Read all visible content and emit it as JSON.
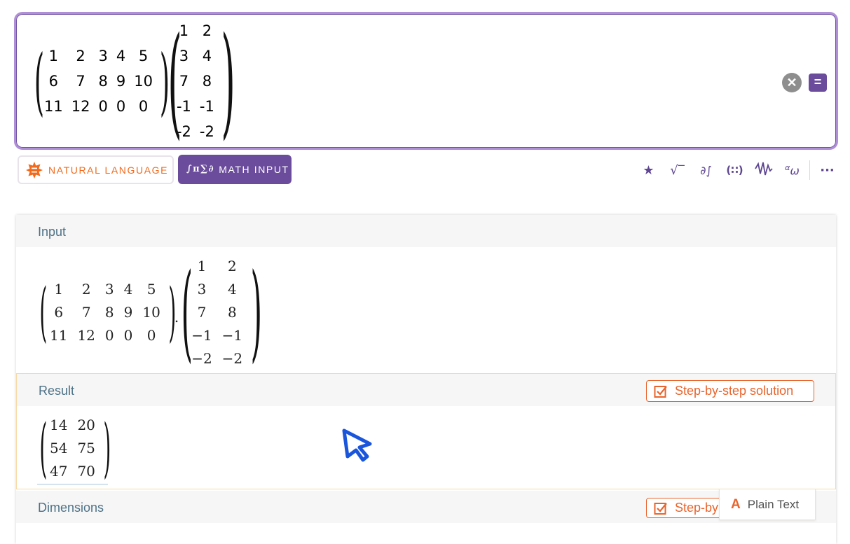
{
  "input": {
    "matrix_a": [
      [
        "1",
        "2",
        "3",
        "4",
        "5"
      ],
      [
        "6",
        "7",
        "8",
        "9",
        "10"
      ],
      [
        "11",
        "12",
        "0",
        "0",
        "0"
      ]
    ],
    "matrix_b": [
      [
        "1",
        "2"
      ],
      [
        "3",
        "4"
      ],
      [
        "7",
        "8"
      ],
      [
        "-1",
        "-1"
      ],
      [
        "-2",
        "-2"
      ]
    ],
    "clear_symbol": "✕",
    "compute_symbol": "="
  },
  "toolbar": {
    "natural_language_label": "NATURAL LANGUAGE",
    "math_input_label": "MATH INPUT",
    "math_input_icon_text": "∫π∑∂",
    "icons": [
      "star-icon",
      "sqrt-icon",
      "calculus-icon",
      "matrix-icon",
      "function-icon",
      "greek-icon",
      "more-icon"
    ]
  },
  "pods": {
    "input": {
      "title": "Input",
      "matrix_a": [
        [
          "1",
          "2",
          "3",
          "4",
          "5"
        ],
        [
          "6",
          "7",
          "8",
          "9",
          "10"
        ],
        [
          "11",
          "12",
          "0",
          "0",
          "0"
        ]
      ],
      "dot": ".",
      "matrix_b": [
        [
          "1",
          "2"
        ],
        [
          "3",
          "4"
        ],
        [
          "7",
          "8"
        ],
        [
          "−1",
          "−1"
        ],
        [
          "−2",
          "−2"
        ]
      ]
    },
    "result": {
      "title": "Result",
      "step_label": "Step-by-step solution",
      "matrix": [
        [
          "14",
          "20"
        ],
        [
          "54",
          "75"
        ],
        [
          "47",
          "70"
        ]
      ]
    },
    "dimensions": {
      "title": "Dimensions",
      "step_label": "Step-by"
    }
  },
  "plain_text_label": "Plain Text",
  "plain_text_icon": "A",
  "colors": {
    "accent_purple": "#6a4b9c",
    "accent_orange": "#e9642c",
    "pod_title": "#4d7287"
  }
}
